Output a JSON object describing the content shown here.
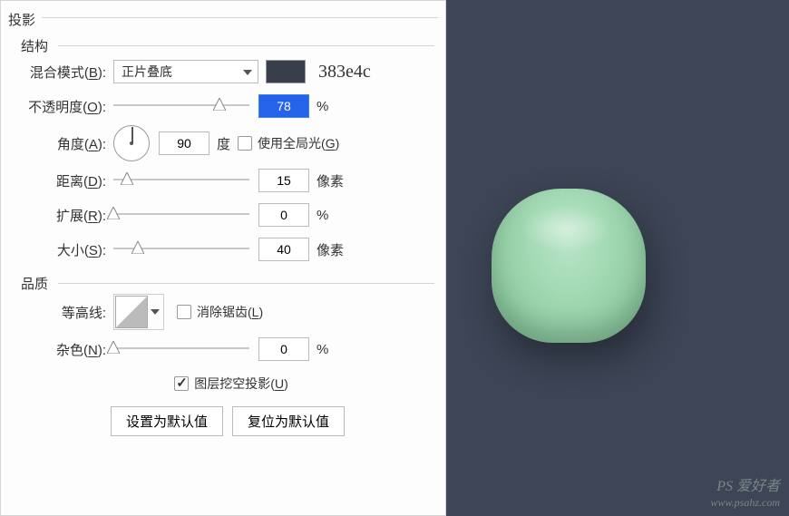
{
  "section_title": "投影",
  "structure": {
    "legend": "结构",
    "blend_mode": {
      "label_pre": "混合模式(",
      "label_key": "B",
      "label_post": "):",
      "value": "正片叠底",
      "hex_display": "383e4c",
      "swatch_color": "#383e4c"
    },
    "opacity": {
      "label_pre": "不透明度(",
      "label_key": "O",
      "label_post": "):",
      "value": "78",
      "unit": "%"
    },
    "angle": {
      "label_pre": "角度(",
      "label_key": "A",
      "label_post": "):",
      "value": "90",
      "unit": "度",
      "global_light_pre": "使用全局光(",
      "global_light_key": "G",
      "global_light_post": ")",
      "global_light_checked": false
    },
    "distance": {
      "label_pre": "距离(",
      "label_key": "D",
      "label_post": "):",
      "value": "15",
      "unit": "像素"
    },
    "spread": {
      "label_pre": "扩展(",
      "label_key": "R",
      "label_post": "):",
      "value": "0",
      "unit": "%"
    },
    "size": {
      "label_pre": "大小(",
      "label_key": "S",
      "label_post": "):",
      "value": "40",
      "unit": "像素"
    }
  },
  "quality": {
    "legend": "品质",
    "contour": {
      "label": "等高线:",
      "antialias_pre": "消除锯齿(",
      "antialias_key": "L",
      "antialias_post": ")",
      "antialias_checked": false
    },
    "noise": {
      "label_pre": "杂色(",
      "label_key": "N",
      "label_post": "):",
      "value": "0",
      "unit": "%"
    }
  },
  "knockout": {
    "label_pre": "图层挖空投影(",
    "label_key": "U",
    "label_post": ")",
    "checked": true
  },
  "buttons": {
    "set_default": "设置为默认值",
    "reset_default": "复位为默认值"
  },
  "watermark": {
    "line1": "PS 爱好者",
    "line2": "www.psahz.com"
  }
}
